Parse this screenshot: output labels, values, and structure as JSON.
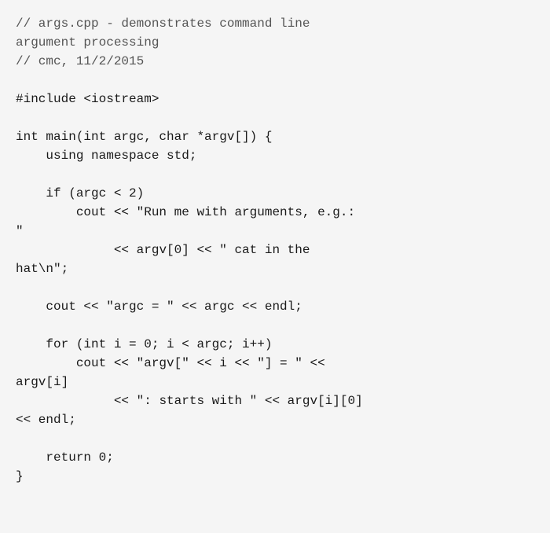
{
  "code": {
    "lines": [
      {
        "id": "line1",
        "text": "// args.cpp - demonstrates command line",
        "type": "comment"
      },
      {
        "id": "line2",
        "text": "argument processing",
        "type": "comment"
      },
      {
        "id": "line3",
        "text": "// cmc, 11/2/2015",
        "type": "comment"
      },
      {
        "id": "line4",
        "text": "",
        "type": "blank"
      },
      {
        "id": "line5",
        "text": "#include <iostream>",
        "type": "code"
      },
      {
        "id": "line6",
        "text": "",
        "type": "blank"
      },
      {
        "id": "line7",
        "text": "int main(int argc, char *argv[]) {",
        "type": "code"
      },
      {
        "id": "line8",
        "text": "    using namespace std;",
        "type": "code"
      },
      {
        "id": "line9",
        "text": "",
        "type": "blank"
      },
      {
        "id": "line10",
        "text": "    if (argc < 2)",
        "type": "code"
      },
      {
        "id": "line11",
        "text": "        cout << \"Run me with arguments, e.g.:",
        "type": "code"
      },
      {
        "id": "line12",
        "text": "\"",
        "type": "code"
      },
      {
        "id": "line13",
        "text": "             << argv[0] << \" cat in the",
        "type": "code"
      },
      {
        "id": "line14",
        "text": "hat\\n\";",
        "type": "code"
      },
      {
        "id": "line15",
        "text": "",
        "type": "blank"
      },
      {
        "id": "line16",
        "text": "    cout << \"argc = \" << argc << endl;",
        "type": "code"
      },
      {
        "id": "line17",
        "text": "",
        "type": "blank"
      },
      {
        "id": "line18",
        "text": "    for (int i = 0; i < argc; i++)",
        "type": "code"
      },
      {
        "id": "line19",
        "text": "        cout << \"argv[\" << i << \"] = \" <<",
        "type": "code"
      },
      {
        "id": "line20",
        "text": "argv[i]",
        "type": "code"
      },
      {
        "id": "line21",
        "text": "             << \": starts with \" << argv[i][0]",
        "type": "code"
      },
      {
        "id": "line22",
        "text": "<< endl;",
        "type": "code"
      },
      {
        "id": "line23",
        "text": "",
        "type": "blank"
      },
      {
        "id": "line24",
        "text": "    return 0;",
        "type": "code"
      },
      {
        "id": "line25",
        "text": "}",
        "type": "code"
      }
    ]
  }
}
